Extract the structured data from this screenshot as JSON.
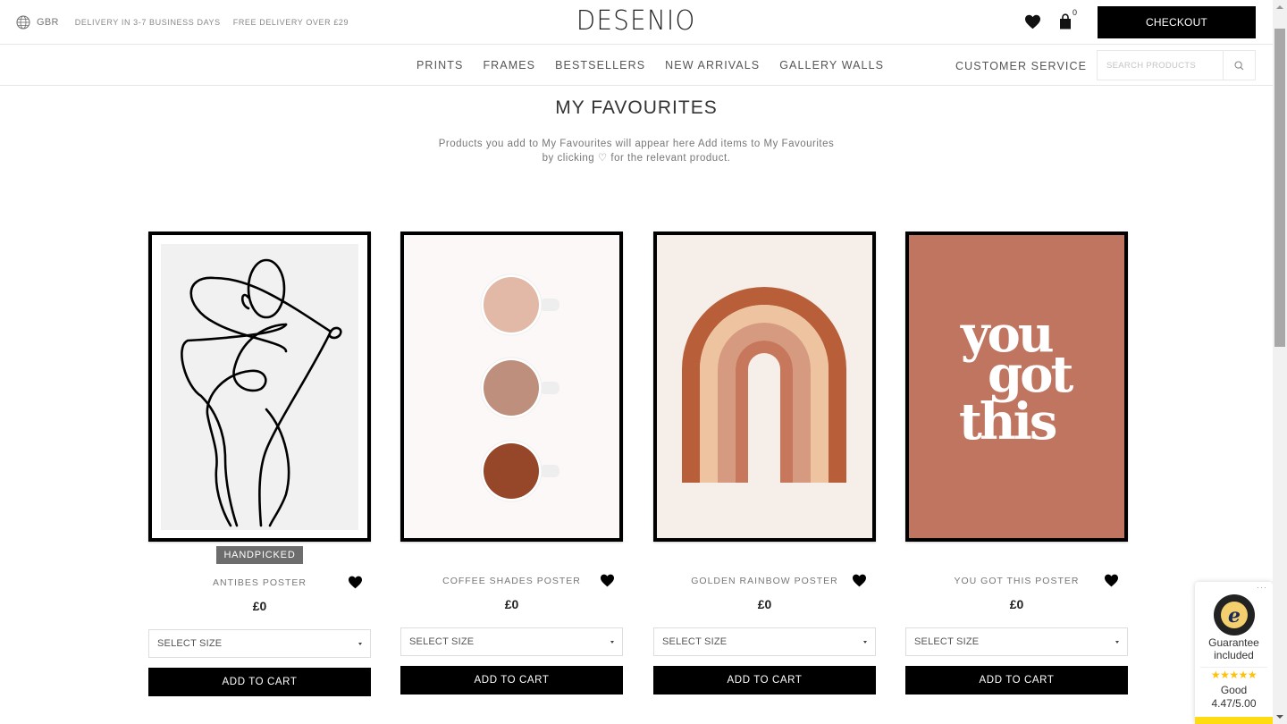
{
  "topbar": {
    "country": "GBR",
    "delivery_time": "DELIVERY IN 3-7 BUSINESS DAYS",
    "free_delivery": "FREE DELIVERY OVER £29",
    "logo": "DESENIO",
    "cart_count": "0",
    "checkout_label": "CHECKOUT"
  },
  "nav": {
    "links": [
      "PRINTS",
      "FRAMES",
      "BESTSELLERS",
      "NEW ARRIVALS",
      "GALLERY WALLS"
    ],
    "customer_service": "CUSTOMER SERVICE",
    "search_placeholder": "SEARCH PRODUCTS"
  },
  "page": {
    "title": "MY FAVOURITES",
    "subtitle_line1": "Products you add to My Favourites will appear here Add items to My Favourites",
    "subtitle_line2": "by clicking ♡ for the relevant product."
  },
  "products": [
    {
      "name": "ANTIBES POSTER",
      "price": "£0",
      "badge": "HANDPICKED",
      "size_placeholder": "SELECT SIZE",
      "add_label": "ADD TO CART",
      "favourited": true
    },
    {
      "name": "COFFEE SHADES POSTER",
      "price": "£0",
      "size_placeholder": "SELECT SIZE",
      "add_label": "ADD TO CART",
      "favourited": true
    },
    {
      "name": "GOLDEN RAINBOW POSTER",
      "price": "£0",
      "size_placeholder": "SELECT SIZE",
      "add_label": "ADD TO CART",
      "favourited": true
    },
    {
      "name": "YOU GOT THIS POSTER",
      "price": "£0",
      "size_placeholder": "SELECT SIZE",
      "add_label": "ADD TO CART",
      "favourited": true,
      "artwork_text": [
        "you",
        "got",
        "this"
      ]
    }
  ],
  "trust_badge": {
    "guarantee_line1": "Guarantee",
    "guarantee_line2": "included",
    "stars": "★★★★★",
    "rating_label": "Good",
    "score": "4.47/5.00",
    "menu": "···"
  },
  "colors": {
    "brand_black": "#000000",
    "badge_gray": "#6d6d6d",
    "terracotta": "#bf7560",
    "trust_yellow": "#ffdc0f"
  }
}
